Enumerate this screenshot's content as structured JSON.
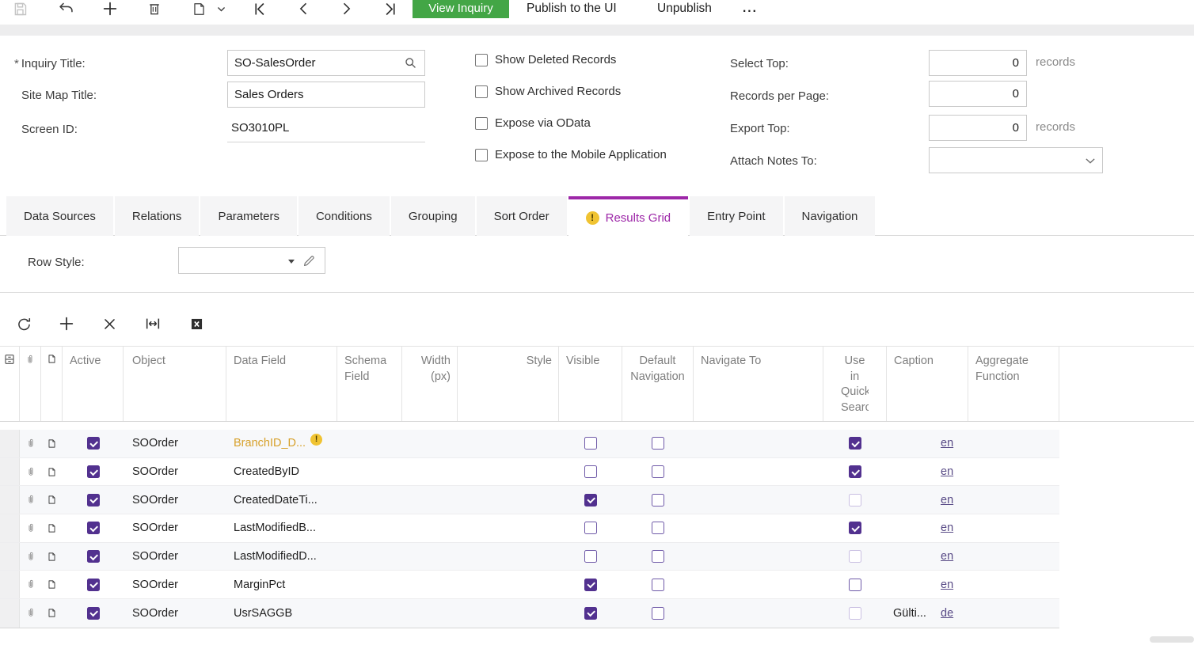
{
  "colors": {
    "accent_green": "#43a646",
    "accent_purple": "#9d27a8",
    "checkbox_purple": "#52318f",
    "warning_yellow": "#f0c331",
    "warning_text_orange": "#d7a02a",
    "link_purple": "#584a86"
  },
  "toolbar": {
    "icon_buttons": [
      "save",
      "undo",
      "add-record",
      "delete-record",
      "copy-note",
      "first-record",
      "previous-record",
      "next-record",
      "last-record"
    ],
    "view_inquiry_label": "View Inquiry",
    "publish_label": "Publish to the UI",
    "unpublish_label": "Unpublish",
    "more_label": "..."
  },
  "form": {
    "inquiry_title": {
      "required_mark": "*",
      "label": "Inquiry Title:",
      "value": "SO-SalesOrder"
    },
    "site_map_title": {
      "label": "Site Map Title:",
      "value": "Sales Orders"
    },
    "screen_id": {
      "label": "Screen ID:",
      "value": "SO3010PL"
    },
    "checkboxes": [
      {
        "label": "Show Deleted Records",
        "checked": false
      },
      {
        "label": "Show Archived Records",
        "checked": false
      },
      {
        "label": "Expose via OData",
        "checked": false
      },
      {
        "label": "Expose to the Mobile Application",
        "checked": false
      }
    ],
    "right_fields": [
      {
        "label": "Select Top:",
        "value": "0",
        "suffix": "records"
      },
      {
        "label": "Records per Page:",
        "value": "0",
        "suffix": ""
      },
      {
        "label": "Export Top:",
        "value": "0",
        "suffix": "records"
      },
      {
        "label": "Attach Notes To:",
        "value": "",
        "suffix": ""
      }
    ]
  },
  "tabs": [
    {
      "label": "Data Sources",
      "active": false,
      "warning": false
    },
    {
      "label": "Relations",
      "active": false,
      "warning": false
    },
    {
      "label": "Parameters",
      "active": false,
      "warning": false
    },
    {
      "label": "Conditions",
      "active": false,
      "warning": false
    },
    {
      "label": "Grouping",
      "active": false,
      "warning": false
    },
    {
      "label": "Sort Order",
      "active": false,
      "warning": false
    },
    {
      "label": "Results Grid",
      "active": true,
      "warning": true
    },
    {
      "label": "Entry Point",
      "active": false,
      "warning": false
    },
    {
      "label": "Navigation",
      "active": false,
      "warning": false
    }
  ],
  "row_style": {
    "label": "Row Style:",
    "value": ""
  },
  "grid_toolbar": [
    "refresh",
    "add-row",
    "delete-row",
    "fit-to-screen",
    "export-to-excel"
  ],
  "grid": {
    "columns": [
      {
        "label": "",
        "icon": "grid-settings-icon"
      },
      {
        "label": "",
        "icon": "paperclip-icon"
      },
      {
        "label": "",
        "icon": "document-icon"
      },
      {
        "label": "Active"
      },
      {
        "label": "Object"
      },
      {
        "label": "Data Field"
      },
      {
        "label": "Schema Field"
      },
      {
        "label": "Width (px)"
      },
      {
        "label": "Style"
      },
      {
        "label": "Visible"
      },
      {
        "label": "Default Navigation"
      },
      {
        "label": "Navigate To"
      },
      {
        "label": "Use in Quick Search"
      },
      {
        "label": "Caption"
      },
      {
        "label": "Aggregate Function"
      }
    ],
    "rows": [
      {
        "object": "SOOrder",
        "data_field": "BranchID_D...",
        "warning": true,
        "active": true,
        "schema_field": "",
        "width_px": "",
        "style": "",
        "visible": false,
        "default_navigation": false,
        "navigate_to": "",
        "use_in_quick_search": true,
        "quick_search_muted": false,
        "caption": "",
        "lang": "en",
        "aggregate_function": ""
      },
      {
        "object": "SOOrder",
        "data_field": "CreatedByID",
        "warning": false,
        "active": true,
        "schema_field": "",
        "width_px": "",
        "style": "",
        "visible": false,
        "default_navigation": false,
        "navigate_to": "",
        "use_in_quick_search": true,
        "quick_search_muted": false,
        "caption": "",
        "lang": "en",
        "aggregate_function": ""
      },
      {
        "object": "SOOrder",
        "data_field": "CreatedDateTi...",
        "warning": false,
        "active": true,
        "schema_field": "",
        "width_px": "",
        "style": "",
        "visible": true,
        "default_navigation": false,
        "navigate_to": "",
        "use_in_quick_search": false,
        "quick_search_muted": true,
        "caption": "",
        "lang": "en",
        "aggregate_function": ""
      },
      {
        "object": "SOOrder",
        "data_field": "LastModifiedB...",
        "warning": false,
        "active": true,
        "schema_field": "",
        "width_px": "",
        "style": "",
        "visible": false,
        "default_navigation": false,
        "navigate_to": "",
        "use_in_quick_search": true,
        "quick_search_muted": false,
        "caption": "",
        "lang": "en",
        "aggregate_function": ""
      },
      {
        "object": "SOOrder",
        "data_field": "LastModifiedD...",
        "warning": false,
        "active": true,
        "schema_field": "",
        "width_px": "",
        "style": "",
        "visible": false,
        "default_navigation": false,
        "navigate_to": "",
        "use_in_quick_search": false,
        "quick_search_muted": true,
        "caption": "",
        "lang": "en",
        "aggregate_function": ""
      },
      {
        "object": "SOOrder",
        "data_field": "MarginPct",
        "warning": false,
        "active": true,
        "schema_field": "",
        "width_px": "",
        "style": "",
        "visible": true,
        "default_navigation": false,
        "navigate_to": "",
        "use_in_quick_search": false,
        "quick_search_muted": false,
        "caption": "",
        "lang": "en",
        "aggregate_function": ""
      },
      {
        "object": "SOOrder",
        "data_field": "UsrSAGGB",
        "warning": false,
        "active": true,
        "schema_field": "",
        "width_px": "",
        "style": "",
        "visible": true,
        "default_navigation": false,
        "navigate_to": "",
        "use_in_quick_search": false,
        "quick_search_muted": true,
        "caption": "Gülti...",
        "lang": "de",
        "aggregate_function": ""
      }
    ]
  }
}
